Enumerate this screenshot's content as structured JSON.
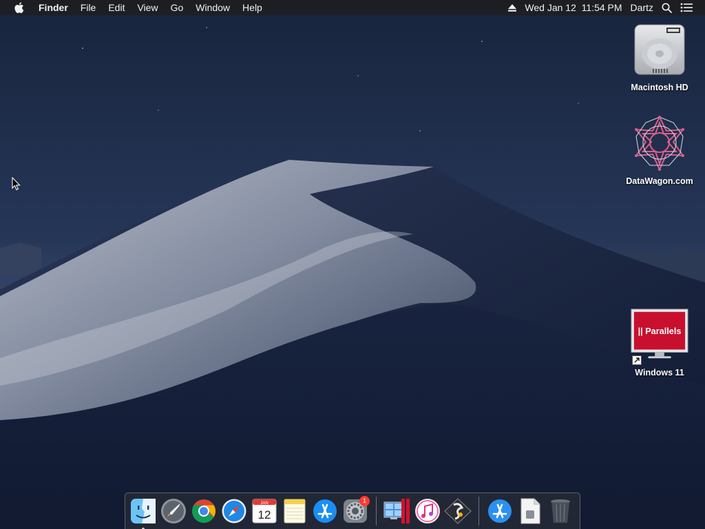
{
  "menubar": {
    "app_name": "Finder",
    "menus": [
      "File",
      "Edit",
      "View",
      "Go",
      "Window",
      "Help"
    ],
    "status": {
      "eject_icon": "eject-icon",
      "datetime": "Wed Jan 12  11:54 PM",
      "user": "Dartz",
      "search_icon": "spotlight-icon",
      "notifications_icon": "notification-center-icon"
    }
  },
  "desktop": {
    "icons": [
      {
        "label": "Macintosh HD",
        "icon": "hard-drive-icon"
      },
      {
        "label": "DataWagon.com",
        "icon": "datawagon-icon"
      },
      {
        "label": "Windows 11",
        "icon": "parallels-vm-icon",
        "inner_text": "|| Parallels"
      }
    ]
  },
  "dock": {
    "apps": [
      {
        "name": "Finder",
        "icon": "finder-icon",
        "running": true
      },
      {
        "name": "Launchpad",
        "icon": "launchpad-icon"
      },
      {
        "name": "Google Chrome",
        "icon": "chrome-icon"
      },
      {
        "name": "Safari",
        "icon": "safari-icon"
      },
      {
        "name": "Calendar",
        "icon": "calendar-icon",
        "month": "JAN",
        "day": "12"
      },
      {
        "name": "Notes",
        "icon": "notes-icon"
      },
      {
        "name": "App Store",
        "icon": "app-store-icon"
      },
      {
        "name": "System Preferences",
        "icon": "system-preferences-icon",
        "badge": "1"
      },
      {
        "name": "Parallels Desktop",
        "icon": "parallels-icon"
      },
      {
        "name": "iTunes",
        "icon": "itunes-icon"
      },
      {
        "name": "Paintbrush",
        "icon": "paintbrush-icon"
      },
      {
        "name": "App Store",
        "icon": "app-store-folder-icon"
      },
      {
        "name": "Document",
        "icon": "document-icon"
      },
      {
        "name": "Trash",
        "icon": "trash-icon"
      }
    ]
  },
  "colors": {
    "sky_top": "#1b2842",
    "sky_bottom": "#394b6e",
    "dune_light": "#aab1c0",
    "dune_dark": "#121c34",
    "menubar_bg": "#1e1e22",
    "badge_red": "#ff3b30",
    "parallels_red": "#c8102e"
  }
}
